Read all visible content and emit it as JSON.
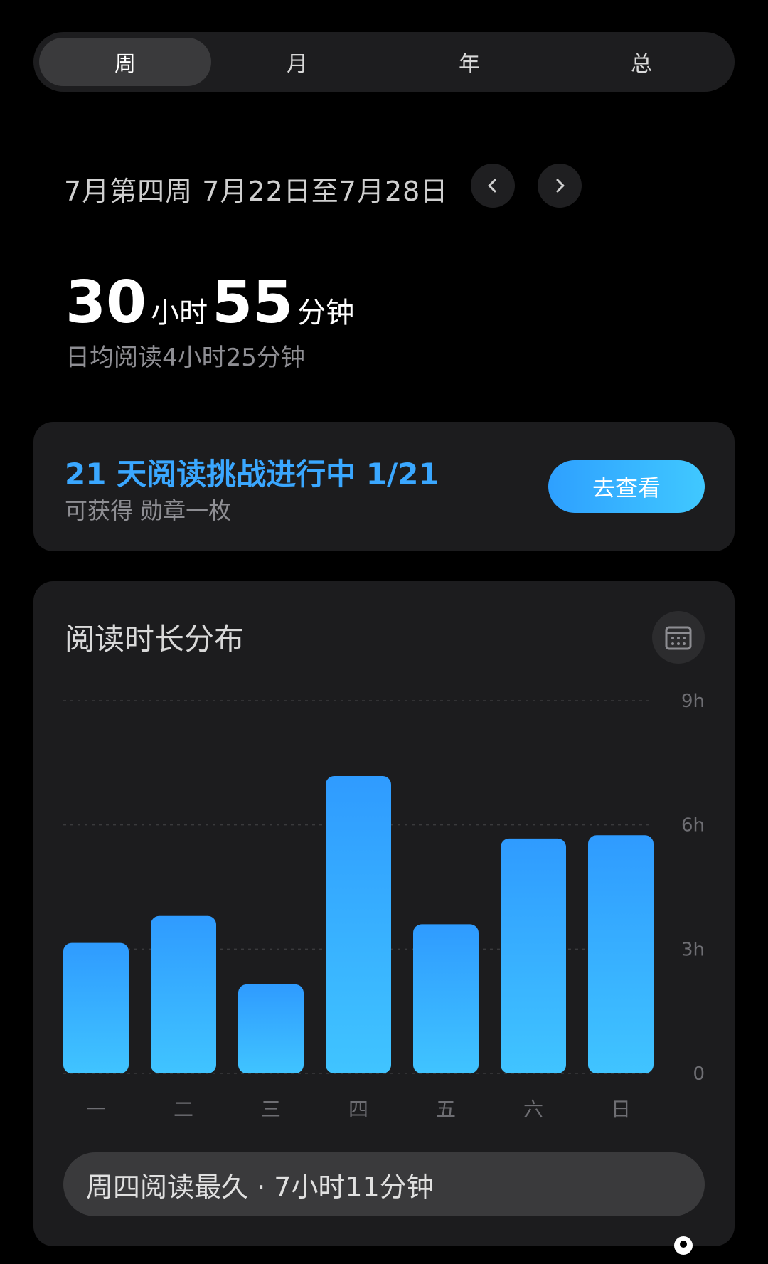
{
  "tabs": [
    {
      "label": "周",
      "active": true
    },
    {
      "label": "月",
      "active": false
    },
    {
      "label": "年",
      "active": false
    },
    {
      "label": "总",
      "active": false
    }
  ],
  "week": {
    "title": "7月第四周 7月22日至7月28日"
  },
  "total": {
    "hours": "30",
    "hours_unit": "小时",
    "minutes": "55",
    "minutes_unit": "分钟",
    "daily_avg": "日均阅读4小时25分钟"
  },
  "challenge": {
    "title": "21 天阅读挑战进行中 1/21",
    "subtitle": "可获得 勋章一枚",
    "button": "去查看"
  },
  "distribution": {
    "title": "阅读时长分布",
    "summary": "周四阅读最久 · 7小时11分钟"
  },
  "colors": {
    "accent": "#3aa7ff",
    "bar_top": "#2f9bff",
    "bar_bottom": "#40c4ff"
  },
  "chart_data": {
    "type": "bar",
    "categories": [
      "一",
      "二",
      "三",
      "四",
      "五",
      "六",
      "日"
    ],
    "values": [
      3.15,
      3.8,
      2.15,
      7.18,
      3.6,
      5.67,
      5.75
    ],
    "unit": "hours",
    "ylim": [
      0,
      9
    ],
    "yticks": [
      {
        "value": 9,
        "label": "9h"
      },
      {
        "value": 6,
        "label": "6h"
      },
      {
        "value": 3,
        "label": "3h"
      },
      {
        "value": 0,
        "label": "0"
      }
    ],
    "grid": true
  }
}
